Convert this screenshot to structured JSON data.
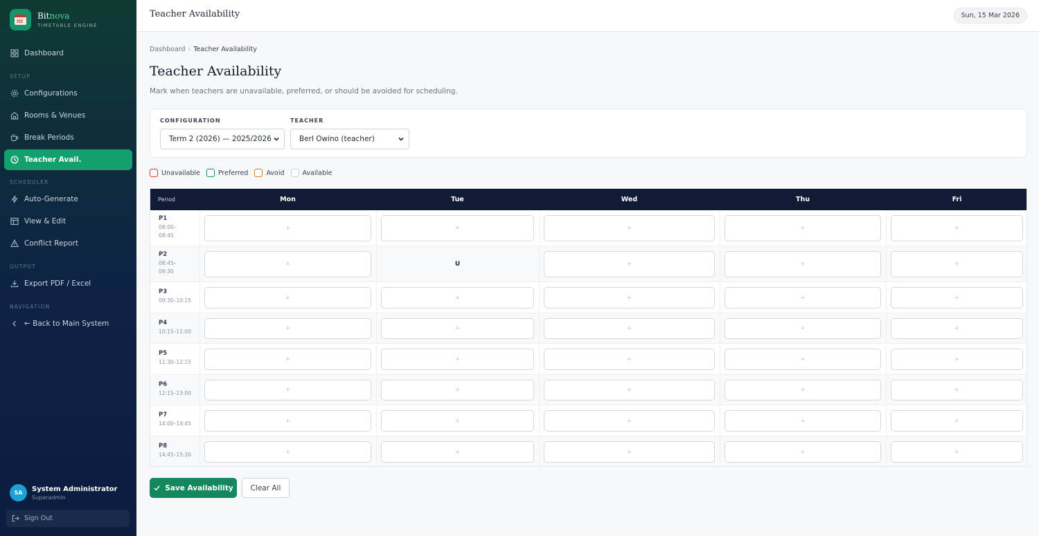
{
  "brand": {
    "name_prefix": "Bit",
    "name_accent": "nova",
    "subtitle": "TIMETABLE ENGINE"
  },
  "sidebar": {
    "dashboard": "Dashboard",
    "setup_label": "SETUP",
    "configurations": "Configurations",
    "rooms": "Rooms & Venues",
    "breaks": "Break Periods",
    "teacher_avail": "Teacher Avail.",
    "scheduler_label": "SCHEDULER",
    "auto_generate": "Auto-Generate",
    "view_edit": "View & Edit",
    "conflict_report": "Conflict Report",
    "output_label": "OUTPUT",
    "export": "Export PDF / Excel",
    "navigation_label": "NAVIGATION",
    "back": "← Back to Main System"
  },
  "user": {
    "initials": "SA",
    "name": "System Administrator",
    "role": "Superadmin",
    "sign_out": "Sign Out"
  },
  "topbar": {
    "title": "Teacher Availability",
    "date": "Sun, 15 Mar 2026"
  },
  "breadcrumb": {
    "root": "Dashboard",
    "sep": "›",
    "current": "Teacher Availability"
  },
  "page": {
    "title": "Teacher Availability",
    "description": "Mark when teachers are unavailable, preferred, or should be avoided for scheduling."
  },
  "filters": {
    "configuration_label": "CONFIGURATION",
    "configuration_value": "Term 2 (2026) — 2025/2026",
    "teacher_label": "TEACHER",
    "teacher_value": "Berl Owino (teacher)"
  },
  "legend": [
    {
      "label": "Unavailable",
      "color": "#dc3b2f"
    },
    {
      "label": "Preferred",
      "color": "#12956a"
    },
    {
      "label": "Avoid",
      "color": "#e07b1f"
    },
    {
      "label": "Available",
      "color": "#c9ced4"
    }
  ],
  "grid": {
    "period_header": "Period",
    "days": [
      "Mon",
      "Tue",
      "Wed",
      "Thu",
      "Fri"
    ],
    "empty_symbol": "+",
    "periods": [
      {
        "name": "P1",
        "time": "08:00–08:45",
        "cells": [
          "+",
          "+",
          "+",
          "+",
          "+"
        ]
      },
      {
        "name": "P2",
        "time": "08:45–09:30",
        "cells": [
          "+",
          "U",
          "+",
          "+",
          "+"
        ]
      },
      {
        "name": "P3",
        "time": "09:30–10:15",
        "cells": [
          "+",
          "+",
          "+",
          "+",
          "+"
        ]
      },
      {
        "name": "P4",
        "time": "10:15–11:00",
        "cells": [
          "+",
          "+",
          "+",
          "+",
          "+"
        ]
      },
      {
        "name": "P5",
        "time": "11:30–12:15",
        "cells": [
          "+",
          "+",
          "+",
          "+",
          "+"
        ]
      },
      {
        "name": "P6",
        "time": "12:15–13:00",
        "cells": [
          "+",
          "+",
          "+",
          "+",
          "+"
        ]
      },
      {
        "name": "P7",
        "time": "14:00–14:45",
        "cells": [
          "+",
          "+",
          "+",
          "+",
          "+"
        ]
      },
      {
        "name": "P8",
        "time": "14:45–15:30",
        "cells": [
          "+",
          "+",
          "+",
          "+",
          "+"
        ]
      }
    ]
  },
  "actions": {
    "save": "Save Availability",
    "clear": "Clear All"
  }
}
